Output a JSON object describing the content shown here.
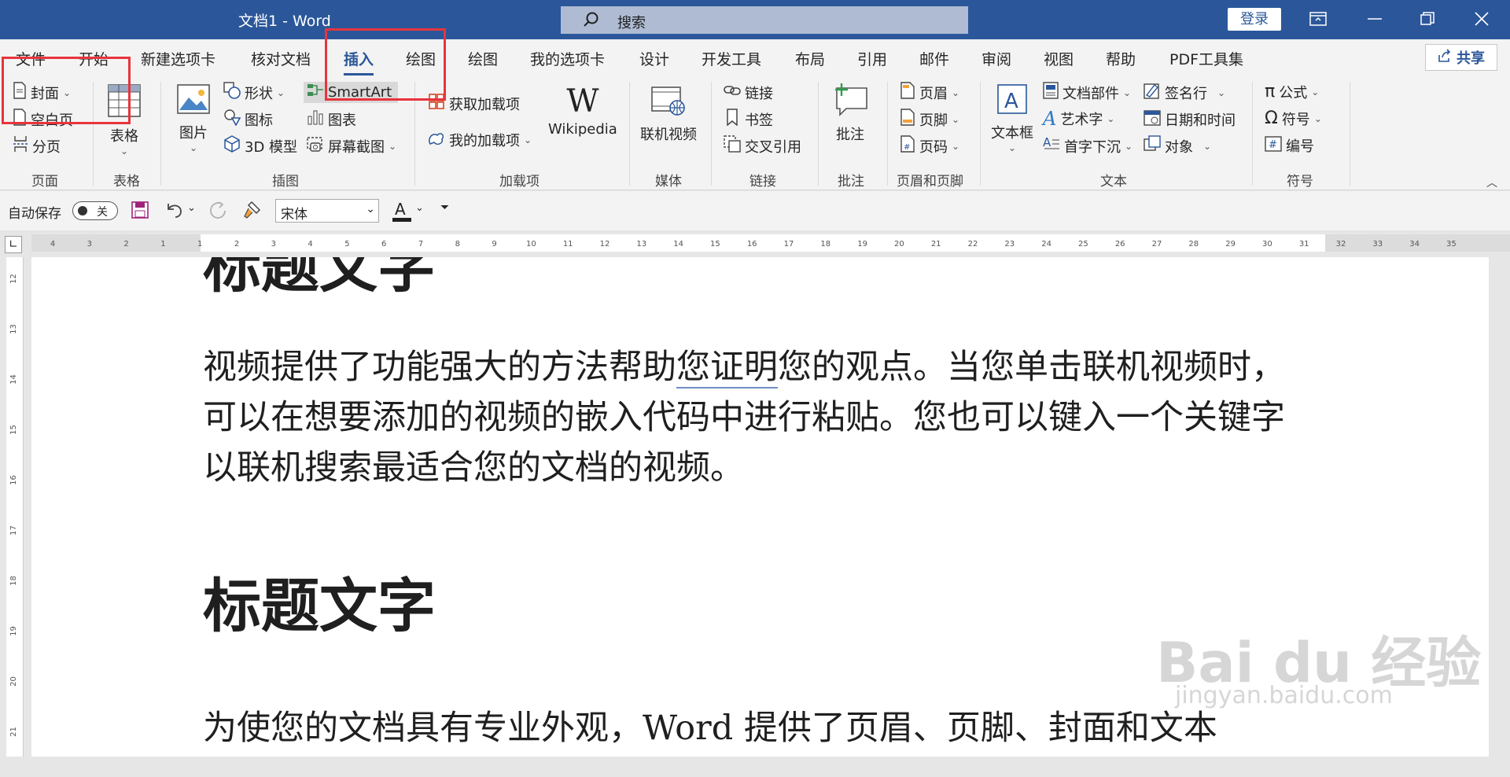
{
  "window": {
    "title": "文档1 - Word",
    "search_placeholder": "搜索",
    "login_label": "登录"
  },
  "tabs": [
    "文件",
    "开始",
    "新建选项卡",
    "核对文档",
    "插入",
    "绘图",
    "绘图",
    "我的选项卡",
    "设计",
    "开发工具",
    "布局",
    "引用",
    "邮件",
    "审阅",
    "视图",
    "帮助",
    "PDF工具集"
  ],
  "active_tab": "插入",
  "share_label": "共享",
  "ribbon": {
    "pages": {
      "label": "页面",
      "cover": "封面",
      "blank": "空白页",
      "break": "分页"
    },
    "tables": {
      "label": "表格",
      "table": "表格"
    },
    "illustrations": {
      "label": "插图",
      "picture": "图片",
      "shapes": "形状",
      "icons": "图标",
      "model3d": "3D 模型",
      "smartart": "SmartArt",
      "chart": "图表",
      "screenshot": "屏幕截图"
    },
    "addins": {
      "label": "加载项",
      "get": "获取加载项",
      "mine": "我的加载项",
      "wikipedia": "Wikipedia"
    },
    "media": {
      "label": "媒体",
      "online_video": "联机视频"
    },
    "links": {
      "label": "链接",
      "link": "链接",
      "bookmark": "书签",
      "crossref": "交叉引用"
    },
    "comments": {
      "label": "批注",
      "comment": "批注"
    },
    "header_footer": {
      "label": "页眉和页脚",
      "header": "页眉",
      "footer": "页脚",
      "page_number": "页码"
    },
    "text": {
      "label": "文本",
      "textbox": "文本框",
      "quickparts": "文档部件",
      "wordart": "艺术字",
      "dropcap": "首字下沉",
      "signature": "签名行",
      "datetime": "日期和时间",
      "object": "对象"
    },
    "symbols": {
      "label": "符号",
      "equation": "公式",
      "symbol": "符号",
      "number": "编号"
    }
  },
  "qat": {
    "autosave_label": "自动保存",
    "autosave_state": "关",
    "font_name": "宋体"
  },
  "ruler": {
    "h_ticks": [
      "4",
      "3",
      "2",
      "1",
      "1",
      "2",
      "3",
      "4",
      "5",
      "6",
      "7",
      "8",
      "9",
      "10",
      "11",
      "12",
      "13",
      "14",
      "15",
      "16",
      "17",
      "18",
      "19",
      "20",
      "21",
      "22",
      "23",
      "24",
      "25",
      "26",
      "27",
      "28",
      "29",
      "30",
      "31",
      "32",
      "33",
      "34",
      "35"
    ],
    "v_ticks": [
      "12",
      "13",
      "14",
      "15",
      "16",
      "17",
      "18",
      "19",
      "20",
      "21"
    ]
  },
  "document": {
    "para1_a": "视频提供了功能强大的方法帮助",
    "para1_u": "您证明",
    "para1_b": "您的观点。当您单击联机视频时，可以在想要添加的视频的嵌入代码中进行粘贴。您也可以键入一个关键字以联机搜索最适合您的文档的视频。",
    "heading": "标题文字",
    "para2": "为使您的文档具有专业外观，Word 提供了页眉、页脚、封面和文本",
    "cut_heading": "标题文字"
  },
  "watermark": {
    "brand": "Bai du 经验",
    "url": "jingyan.baidu.com"
  },
  "colors": {
    "titlebar": "#2b579a",
    "accent": "#2b579a",
    "annotation": "#e8343c"
  }
}
